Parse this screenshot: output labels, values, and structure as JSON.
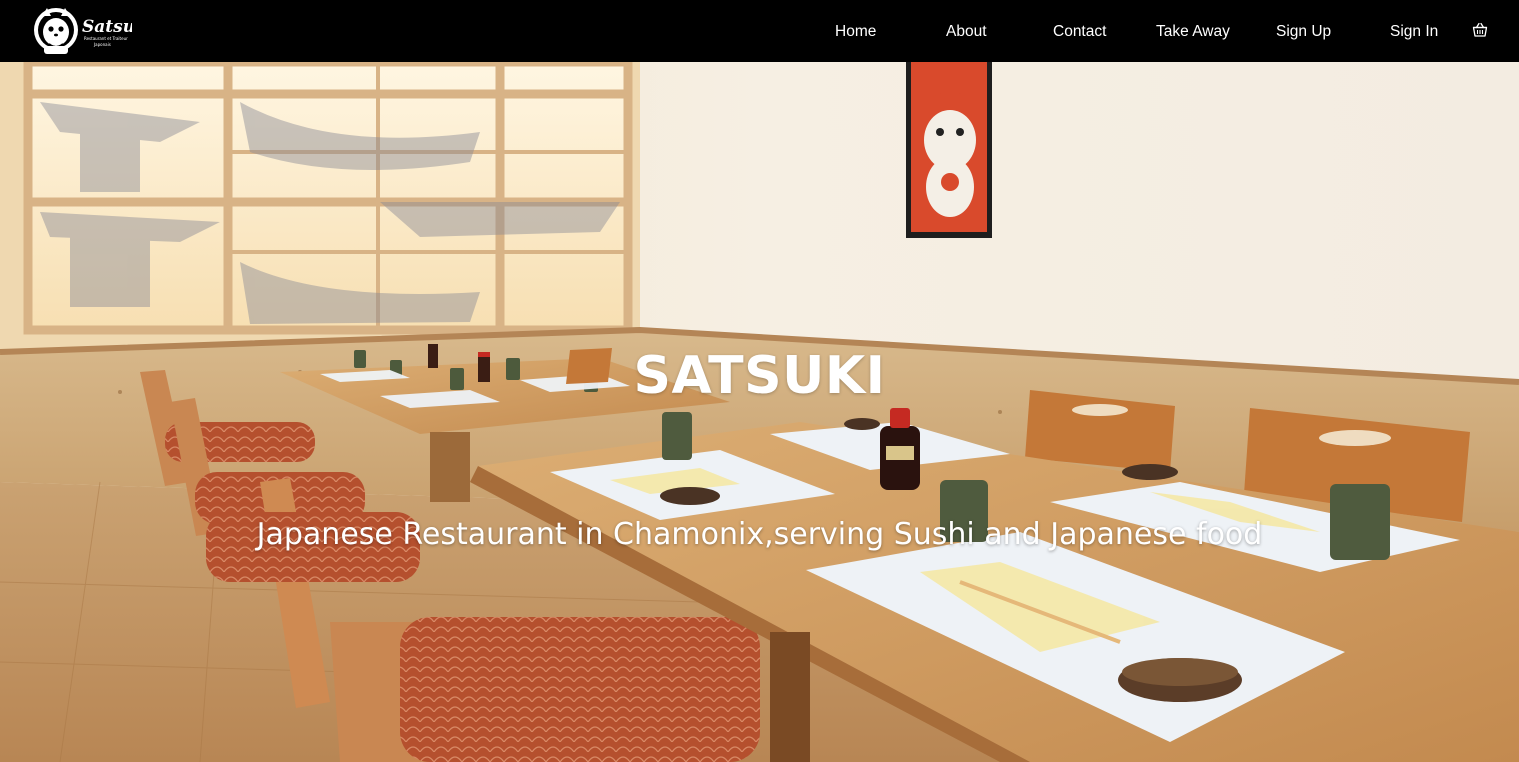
{
  "brand": {
    "logo_text": "Satsuki",
    "logo_tagline": "Restaurant et Traiteur Japonais"
  },
  "nav": {
    "home": "Home",
    "about": "About",
    "contact": "Contact",
    "take_away": "Take Away",
    "sign_up": "Sign Up",
    "sign_in": "Sign In",
    "cart_icon": "basket-icon"
  },
  "hero": {
    "title": "SATSUKI",
    "subtitle": "Japanese Restaurant in Chamonix,serving Sushi and Japanese food",
    "image_icon": "restaurant-interior-photo"
  },
  "colors": {
    "navbar_bg": "#000000",
    "nav_text": "#ffffff",
    "hero_text": "#ffffff"
  }
}
